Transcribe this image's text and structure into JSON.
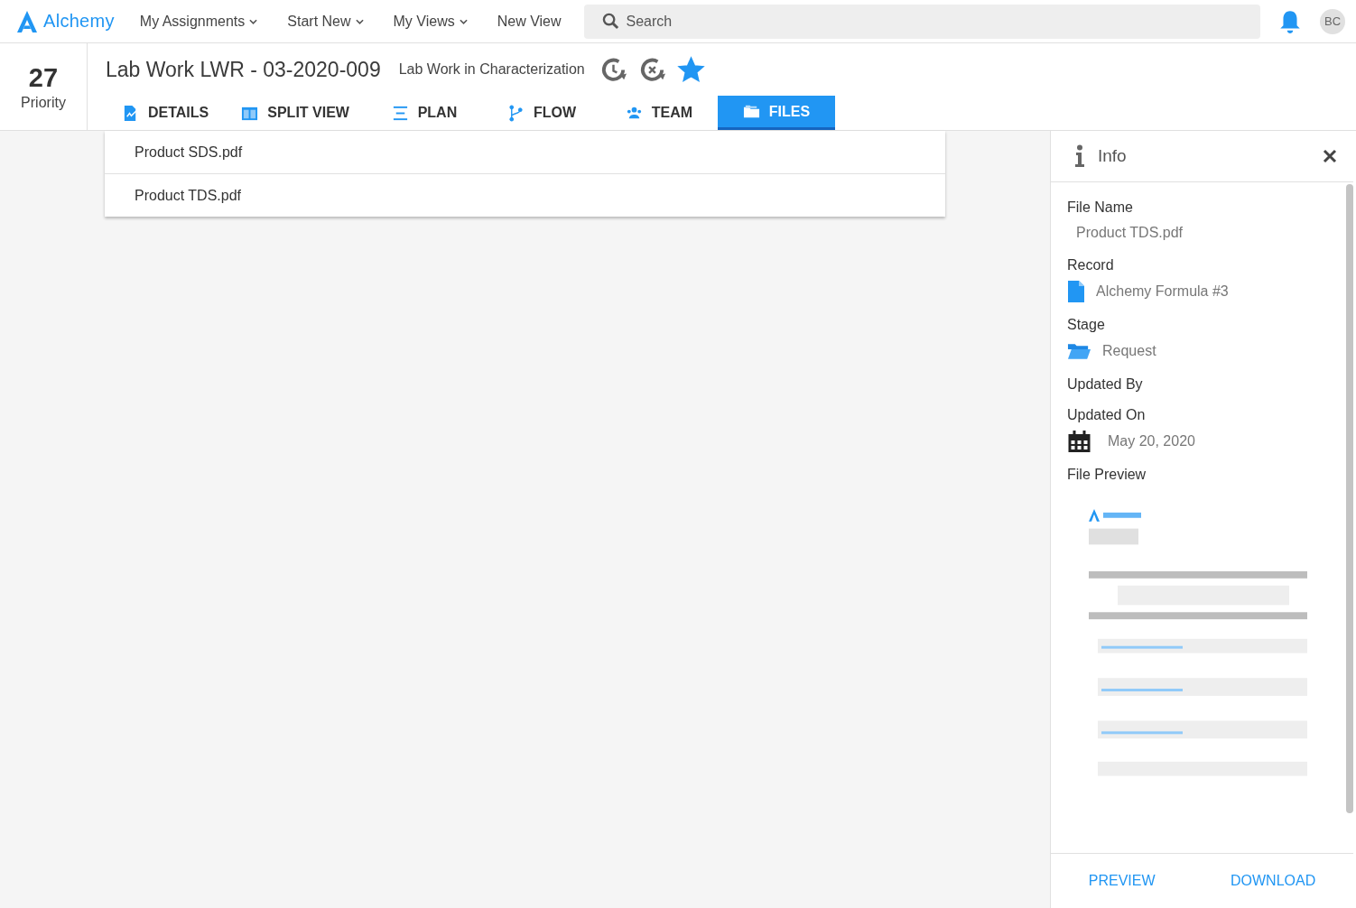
{
  "app": {
    "name": "Alchemy"
  },
  "nav": [
    {
      "label": "My Assignments",
      "dropdown": true
    },
    {
      "label": "Start New",
      "dropdown": true
    },
    {
      "label": "My Views",
      "dropdown": true
    },
    {
      "label": "New View",
      "dropdown": false
    }
  ],
  "search": {
    "placeholder": "Search"
  },
  "user": {
    "initials": "BC"
  },
  "record": {
    "priority": "27",
    "priority_label": "Priority",
    "title": "Lab Work LWR - 03-2020-009",
    "status": "Lab Work in Characterization",
    "starred": true
  },
  "tabs": [
    {
      "label": "DETAILS",
      "kind": "details",
      "selected": false
    },
    {
      "label": "SPLIT VIEW",
      "kind": "split",
      "selected": false
    },
    {
      "label": "PLAN",
      "kind": "plan",
      "selected": false
    },
    {
      "label": "FLOW",
      "kind": "flow",
      "selected": false
    },
    {
      "label": "TEAM",
      "kind": "team",
      "selected": false
    },
    {
      "label": "FILES",
      "kind": "files",
      "selected": true
    }
  ],
  "files": [
    {
      "name": "Product SDS.pdf"
    },
    {
      "name": "Product TDS.pdf"
    }
  ],
  "info": {
    "title": "Info",
    "fields": [
      {
        "label": "File Name",
        "kind": "text",
        "value": "Product TDS.pdf"
      },
      {
        "label": "Record",
        "kind": "record",
        "value": "Alchemy Formula #3"
      },
      {
        "label": "Stage",
        "kind": "stage",
        "value": "Request"
      },
      {
        "label": "Updated By",
        "kind": "empty"
      },
      {
        "label": "Updated On",
        "kind": "date",
        "value": "May 20, 2020"
      },
      {
        "label": "File Preview",
        "kind": "preview"
      }
    ],
    "actions": [
      "PREVIEW",
      "DOWNLOAD"
    ]
  }
}
